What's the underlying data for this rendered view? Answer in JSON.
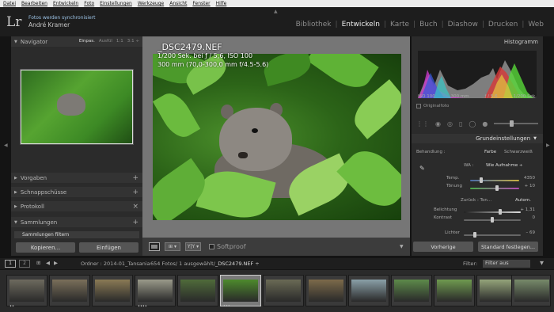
{
  "menubar": [
    "Datei",
    "Bearbeiten",
    "Entwickeln",
    "Foto",
    "Einstellungen",
    "Werkzeuge",
    "Ansicht",
    "Fenster",
    "Hilfe"
  ],
  "identity": {
    "logo": "Lr",
    "sync": "Fotos werden synchronisiert",
    "user": "André Kramer"
  },
  "modules": [
    {
      "label": "Bibliothek",
      "active": false
    },
    {
      "label": "Entwickeln",
      "active": true
    },
    {
      "label": "Karte",
      "active": false
    },
    {
      "label": "Buch",
      "active": false
    },
    {
      "label": "Diashow",
      "active": false
    },
    {
      "label": "Drucken",
      "active": false
    },
    {
      "label": "Web",
      "active": false
    }
  ],
  "left_panel": {
    "navigator": "Navigator",
    "nav_options": [
      "Einpas.",
      "Ausfül",
      "1:1",
      "3:1 ÷"
    ],
    "presets": "Vorgaben",
    "snapshots": "Schnappschüsse",
    "history": "Protokoll",
    "collections": "Sammlungen",
    "filter_collections": "Sammlungen filtern",
    "copy_button": "Kopieren...",
    "paste_button": "Einfügen"
  },
  "photo_info": {
    "filename": "_DSC2479.NEF",
    "line1": "1/200 Sek. bei ƒ / 5,6, ISO 100",
    "line2": "300 mm (70,0-300,0 mm f/4.5-5.6)"
  },
  "toolbar": {
    "softproof": "Softproof"
  },
  "right_panel": {
    "histogram_title": "Histogramm",
    "hist_info": [
      "ISO 100",
      "300 mm",
      "ƒ / 5,6",
      "1/200 Sek."
    ],
    "original_photo": "Originalfoto",
    "basic_title": "Grundeinstellungen",
    "treatment_label": "Behandlung :",
    "treatment_color": "Farbe",
    "treatment_bw": "Schwarzweiß",
    "wb_label": "WA :",
    "wb_value": "Wie Aufnahme ÷",
    "temp_label": "Temp.",
    "temp_value": "4350",
    "tint_label": "Tönung",
    "tint_value": "+ 10",
    "tone_label": "Zurück : Ton...",
    "auto_label": "Autom.",
    "exposure_label": "Belichtung",
    "exposure_value": "+ 1,31",
    "contrast_label": "Kontrast",
    "contrast_value": "0",
    "lights_label": "Lichter",
    "lights_value": "– 69",
    "prev_button": "Vorherige",
    "default_button": "Standard festlegen..."
  },
  "filmbar": {
    "page1": "1",
    "page2": "2",
    "source": "Ordner : 2014-01_Tansania",
    "count": "654 Fotos/ 1 ausgewählt/",
    "selected_file": "_DSC2479.NEF ÷",
    "filter_label": "Filter:",
    "filter_value": "Filter aus"
  },
  "filmstrip": [
    {
      "stars": "••",
      "color": "#6d6a5e",
      "selected": false
    },
    {
      "stars": "",
      "color": "#7a6f5a",
      "selected": false
    },
    {
      "stars": "",
      "color": "#8a7a55",
      "selected": false
    },
    {
      "stars": "••••",
      "color": "#9a9a8a",
      "selected": false
    },
    {
      "stars": "",
      "color": "#4f6b3a",
      "selected": false
    },
    {
      "stars": "•••",
      "color": "#4d8a2c",
      "selected": true
    },
    {
      "stars": "",
      "color": "#6a6a55",
      "selected": false
    },
    {
      "stars": "",
      "color": "#7c6a4a",
      "selected": false
    },
    {
      "stars": "",
      "color": "#8aa0a8",
      "selected": false
    },
    {
      "stars": "",
      "color": "#5d8a4a",
      "selected": false
    },
    {
      "stars": "",
      "color": "#6f9a4f",
      "selected": false
    },
    {
      "stars": "",
      "color": "#94a47a",
      "selected": false
    },
    {
      "stars": "",
      "color": "#778a6a",
      "selected": false
    }
  ]
}
